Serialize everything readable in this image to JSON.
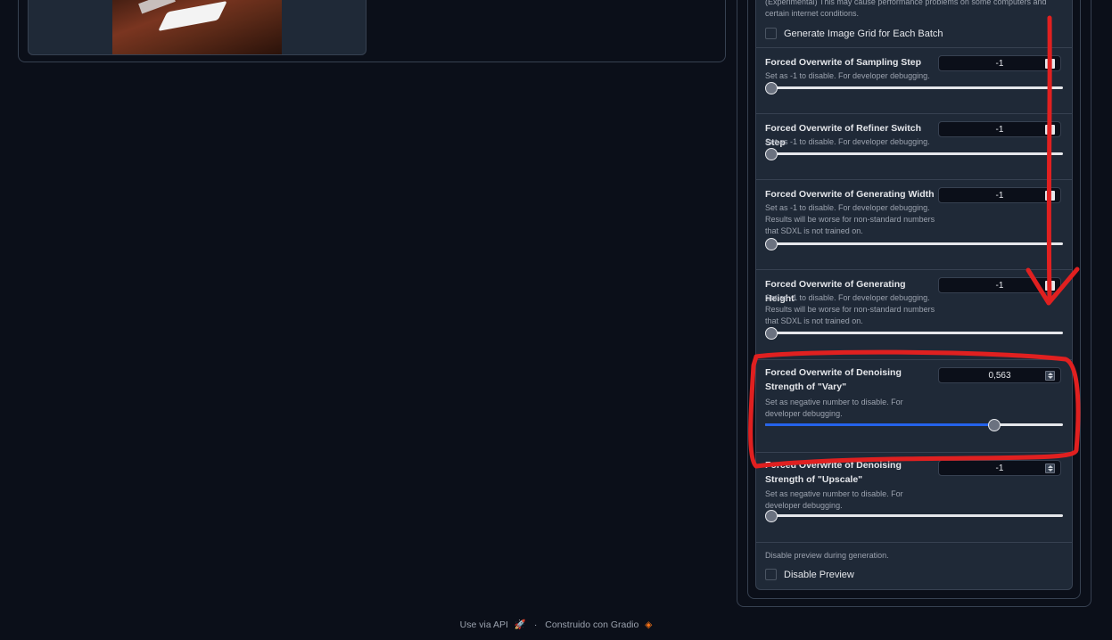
{
  "top_note": "(Experimental) This may cause performance problems on some computers and certain internet conditions.",
  "grid_checkbox_label": "Generate Image Grid for Each Batch",
  "sections": [
    {
      "title": "Forced Overwrite of Sampling Step",
      "desc": "Set as -1 to disable. For developer debugging.",
      "value": "-1",
      "fraction": 0
    },
    {
      "title": "Forced Overwrite of Refiner Switch Step",
      "desc": "Set as -1 to disable. For developer debugging.",
      "value": "-1",
      "fraction": 0
    },
    {
      "title": "Forced Overwrite of Generating Width",
      "desc": "Set as -1 to disable. For developer debugging. Results will be worse for non-standard numbers that SDXL is not trained on.",
      "value": "-1",
      "fraction": 0
    },
    {
      "title": "Forced Overwrite of Generating Height",
      "desc": "Set as -1 to disable. For developer debugging. Results will be worse for non-standard numbers that SDXL is not trained on.",
      "value": "-1",
      "fraction": 0
    },
    {
      "title": "Forced Overwrite of Denoising Strength of \"Vary\"",
      "desc": "Set as negative number to disable. For developer debugging.",
      "value": "0,563",
      "fraction": 0.77
    },
    {
      "title": "Forced Overwrite of Denoising Strength of \"Upscale\"",
      "desc": "Set as negative number to disable. For developer debugging.",
      "value": "-1",
      "fraction": 0
    }
  ],
  "preview_note": "Disable preview during generation.",
  "preview_checkbox_label": "Disable Preview",
  "footer": {
    "api_label": "Use via API",
    "separator": "·",
    "built_with": "Construido con Gradio"
  },
  "colors": {
    "background": "#0b0f19",
    "panel": "#1f2937",
    "border": "#374151",
    "accent": "#2563eb",
    "annotation": "#e02020"
  },
  "icons": {
    "footer_api": "rocket-icon",
    "footer_gradio": "gradio-logo-icon"
  }
}
